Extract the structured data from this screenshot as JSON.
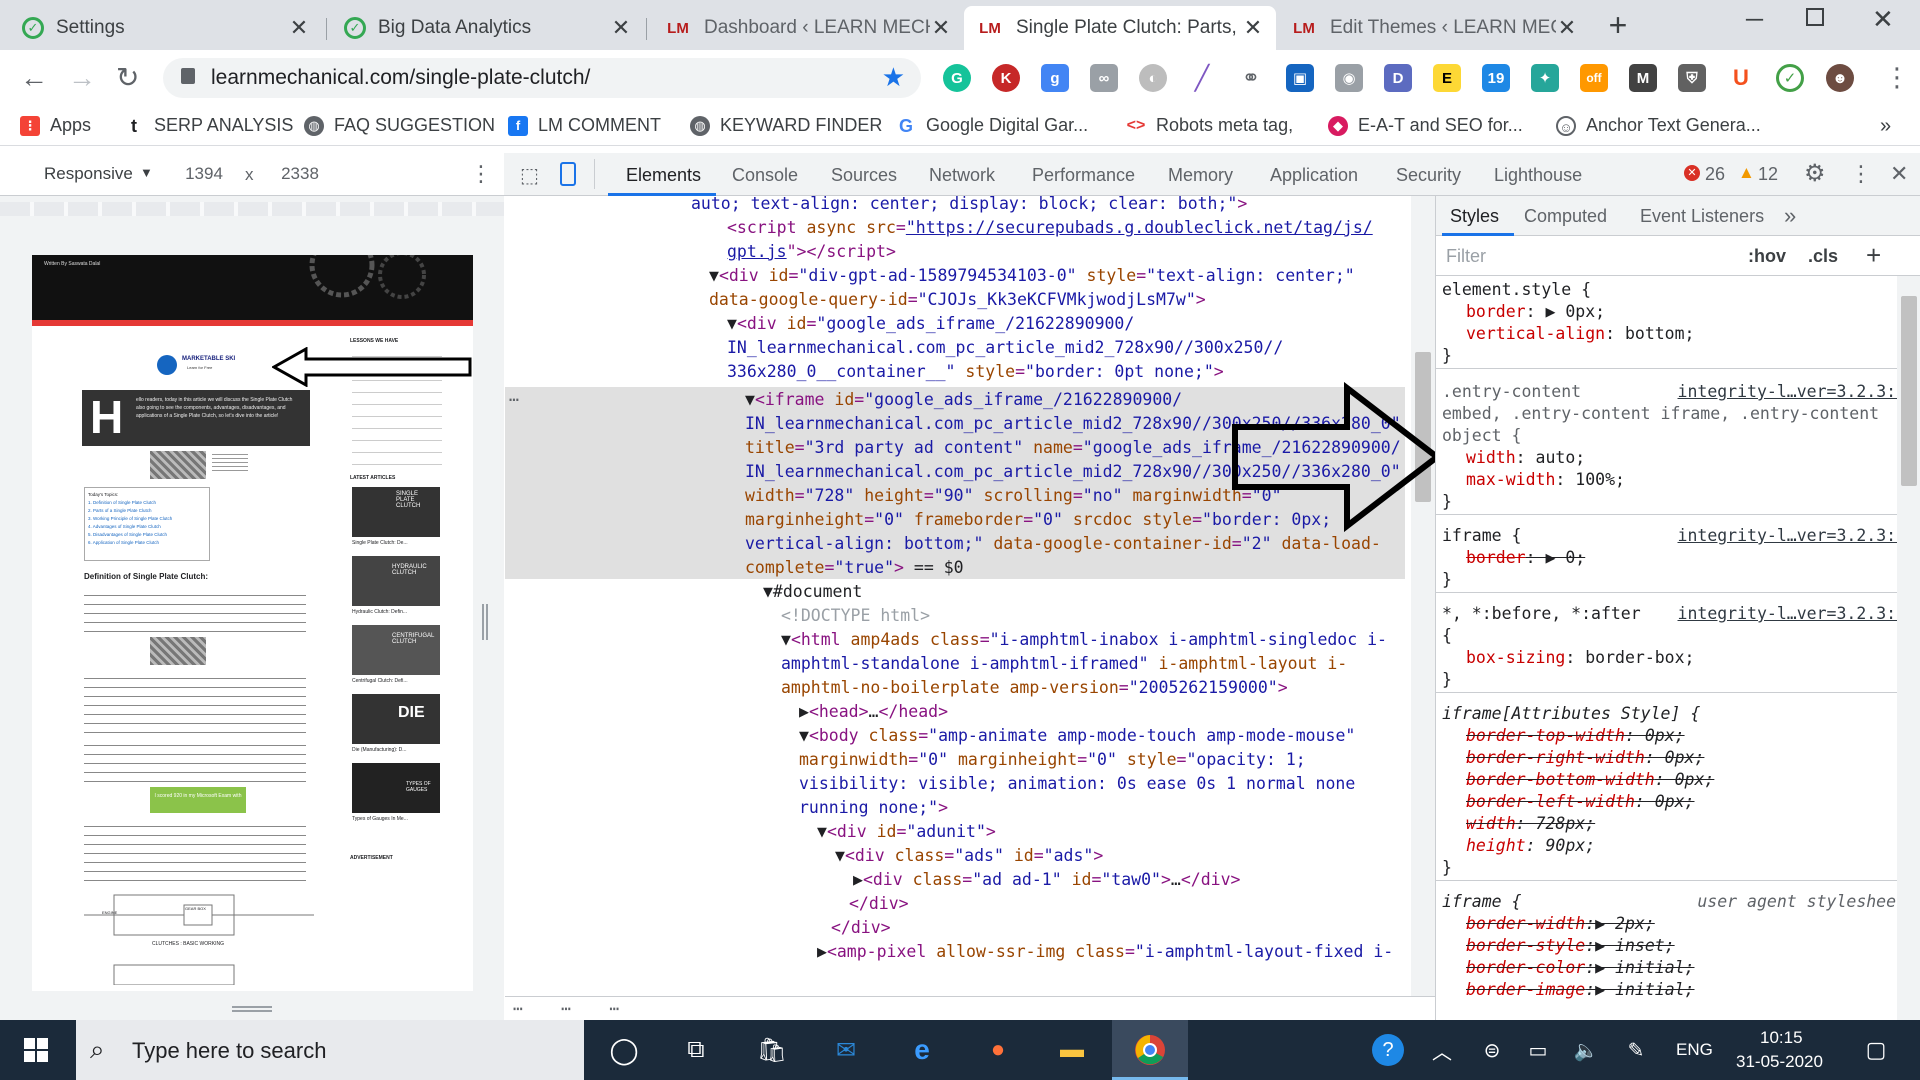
{
  "tabs": [
    {
      "title": "Settings",
      "icon": "settings-favicon-icon"
    },
    {
      "title": "Big Data Analytics",
      "icon": "green-check-favicon-icon"
    },
    {
      "title": "Dashboard ‹ LEARN MECHA",
      "icon": "lm-favicon-icon"
    },
    {
      "title": "Single Plate Clutch: Parts, W",
      "icon": "lm-favicon-icon"
    },
    {
      "title": "Edit Themes ‹ LEARN MECH",
      "icon": "lm-favicon-icon"
    }
  ],
  "address": {
    "url": "learnmechanical.com/single-plate-clutch/"
  },
  "bookmarks": [
    {
      "label": "Apps"
    },
    {
      "label": "SERP ANALYSIS"
    },
    {
      "label": "FAQ SUGGESTION"
    },
    {
      "label": "LM COMMENT"
    },
    {
      "label": "KEYWARD FINDER"
    },
    {
      "label": "Google Digital Gar..."
    },
    {
      "label": "Robots meta tag,"
    },
    {
      "label": "E-A-T and SEO for..."
    },
    {
      "label": "Anchor Text Genera..."
    }
  ],
  "device": {
    "mode": "Responsive",
    "width": "1394",
    "height": "2338",
    "sep": "x"
  },
  "devtools": {
    "tabs": [
      "Elements",
      "Console",
      "Sources",
      "Network",
      "Performance",
      "Memory",
      "Application",
      "Security",
      "Lighthouse"
    ],
    "errors": "26",
    "warnings": "12"
  },
  "styles_tabs": [
    "Styles",
    "Computed",
    "Event Listeners"
  ],
  "filter": {
    "placeholder": "Filter",
    "hov": ":hov",
    "cls": ".cls"
  },
  "preview": {
    "byline": "Written By Saswata Dalal",
    "logo_text": "MARKETABLE SKI",
    "logo_sub": "Learn for Free",
    "intro": "ello readers, today in this article we will discuss the Single Plate Clutch also going to see the components, advantages, disadvantages, and applications of a Single Plate Clutch, so let's dive into the article!",
    "drop_cap": "H",
    "topics_title": "Today's Topics:",
    "topics": [
      "1. Definition of Single Plate Clutch",
      "2. Parts of a Single Plate Clutch",
      "3. Working Principle of Single Plate Clutch",
      "4. Advantages of Single Plate Clutch",
      "5. Disadvantages of Single Plate Clutch",
      "6. Application of Single Plate Clutch"
    ],
    "def_heading": "Definition of Single Plate Clutch:",
    "exam_text": "I scored 920 in my Microsoft Exam with",
    "sidebar_lessons": "LESSONS WE HAVE",
    "sidebar_latest": "LATEST ARTICLES",
    "sidebar_ad": "ADVERTISEMENT",
    "articles": [
      {
        "thumb": "SINGLE PLATE CLUTCH",
        "caption": "Single Plate Clutch: De..."
      },
      {
        "thumb": "HYDRAULIC CLUTCH",
        "caption": "Hydraulic Clutch: Defin..."
      },
      {
        "thumb": "CENTRIFUGAL CLUTCH",
        "caption": "Centrifugal Clutch: Defi..."
      },
      {
        "thumb": "DIE",
        "caption": "Die (Manufacturing): D..."
      },
      {
        "thumb": "TYPES OF GAUGES",
        "caption": "Types of Gauges In Me..."
      }
    ],
    "diagram_label": "CLUTCHES : BASIC WORKING",
    "engine": "ENGINE",
    "gearbox": "GEAR BOX"
  },
  "taskbar": {
    "search": "Type here to search",
    "lang": "ENG",
    "time": "10:15",
    "date": "31-05-2020"
  }
}
